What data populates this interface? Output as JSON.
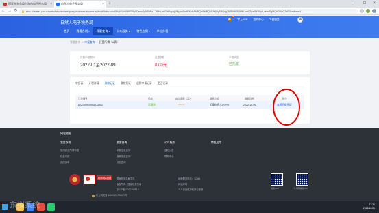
{
  "browser": {
    "tabs": [
      {
        "title": "国家税务总局上海市电子税务局"
      },
      {
        "title": "自然人电子税务局"
      }
    ],
    "new_tab": "+",
    "url": "etax.chinatax.gov.cn/webstatic/declare/query-business-income-a/detail?tabs=chu8&taNYpkY9IIPWp5Dsmc4yNBbPx L7IPhk,wti2NkMybjMNypwDmtEKyfxSMBQzi5MBQc5JiQOy5BQ4gZ8JEI6iKB6MKLmk0Zywi7Y8Vyd,zlmnRqMQHDAuG2bE0emKmm4..."
  },
  "header": {
    "site_title": "自然人电子税务局",
    "nav": [
      {
        "label": "首页"
      },
      {
        "label": "我要办税"
      },
      {
        "label": "我要查询"
      },
      {
        "label": "公众服务"
      },
      {
        "label": "特色应用"
      },
      {
        "label": "单位办税"
      }
    ],
    "nav_arrow": "▾",
    "badge_count": "19",
    "links": [
      "掌上APP",
      "我的中心",
      "个税服务"
    ],
    "avatar_name": "avatar"
  },
  "breadcrumb": {
    "items": [
      "我要查询",
      ">",
      "申报查询",
      ">"
    ],
    "current": "经营所得（A表）"
  },
  "summary": {
    "period_label": "所属申报期间",
    "period_value": "2022-01至2022-09",
    "tax_label": "应退税额",
    "tax_value": "0.00元",
    "status_label": "申报状态",
    "status_value": "已完成"
  },
  "subtabs": [
    "申报表",
    "计税详情",
    "缴款记录",
    "缴款凭证",
    "退税申请记录",
    "更正记录"
  ],
  "table": {
    "headers": [
      "订单编号",
      "状态",
      "应付金额（元）",
      "缴款方式",
      "缴款日期",
      "操作"
    ],
    "rows": [
      {
        "order": "622100910955213452",
        "status": "已缴税",
        "amount": "****.**",
        "method": "扣缴义务人(bank)",
        "date": "2022-10-09",
        "action": "查看明细凭证"
      }
    ]
  },
  "footer": {
    "heading": "网站地图",
    "columns": [
      {
        "title": "我要办税",
        "items": [
          "常用综合所得申报",
          "税费申报",
          "我的保单"
        ]
      },
      {
        "title": "我要查询",
        "items": [
          "申报信息查询",
          "缴款信息查询",
          "其他查询"
        ]
      },
      {
        "title": "公众服务",
        "items": [
          "通知公告",
          "帮助中心"
        ]
      },
      {
        "title": "特色应用",
        "items": []
      }
    ],
    "info_left": [
      "国家税务总局主办",
      "版权所有：国家税务总局",
      "京ICP备13021385号-2",
      "京公网安备 11040102700073号"
    ],
    "info_right": [
      "纳税服务热线：12366",
      "网站声明",
      "个人信息保护政策与使用"
    ],
    "gov_logo_text": "政府网站找错",
    "qr_labels": [
      "税务APP",
      "个人所得税APP"
    ]
  },
  "taskbar": {
    "time": "13:31",
    "date": "2022/10/21"
  },
  "watermark": "东拟系统"
}
